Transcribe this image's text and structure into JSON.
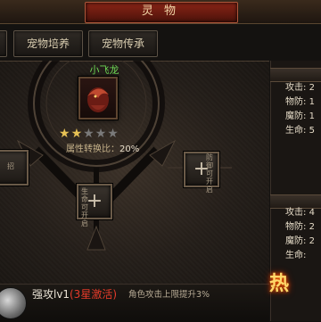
{
  "window": {
    "title": "灵 物"
  },
  "tabs": [
    {
      "label": "宠物培养"
    },
    {
      "label": "宠物传承"
    }
  ],
  "pet": {
    "name": "小飞龙",
    "stars_total": 5,
    "stars_filled": 2,
    "conversion_label": "属性转换比：",
    "conversion_value": "20%"
  },
  "slots": [
    {
      "glyph": "+",
      "text": "招"
    },
    {
      "glyph": "+",
      "text": "生 命 可 开 启"
    },
    {
      "glyph": "+",
      "text": "防 御 可 开 启"
    }
  ],
  "stats_group_1": [
    {
      "label": "攻击:",
      "value": "2"
    },
    {
      "label": "物防:",
      "value": "1"
    },
    {
      "label": "魔防:",
      "value": "1"
    },
    {
      "label": "生命:",
      "value": "5"
    }
  ],
  "stats_group_2": [
    {
      "label": "攻击:",
      "value": "4"
    },
    {
      "label": "物防:",
      "value": "2"
    },
    {
      "label": "魔防:",
      "value": "2"
    },
    {
      "label": "生命:",
      "value": ""
    }
  ],
  "skill": {
    "name": "强攻lv1",
    "condition": "(3星激活)",
    "description": "角色攻击上限提升3%"
  },
  "promo": {
    "text": "热"
  },
  "colors": {
    "title_red": "#8a2416",
    "pet_name_green": "#6fdc56",
    "star_gold": "#e7c255",
    "condition_red": "#e43b2a"
  }
}
